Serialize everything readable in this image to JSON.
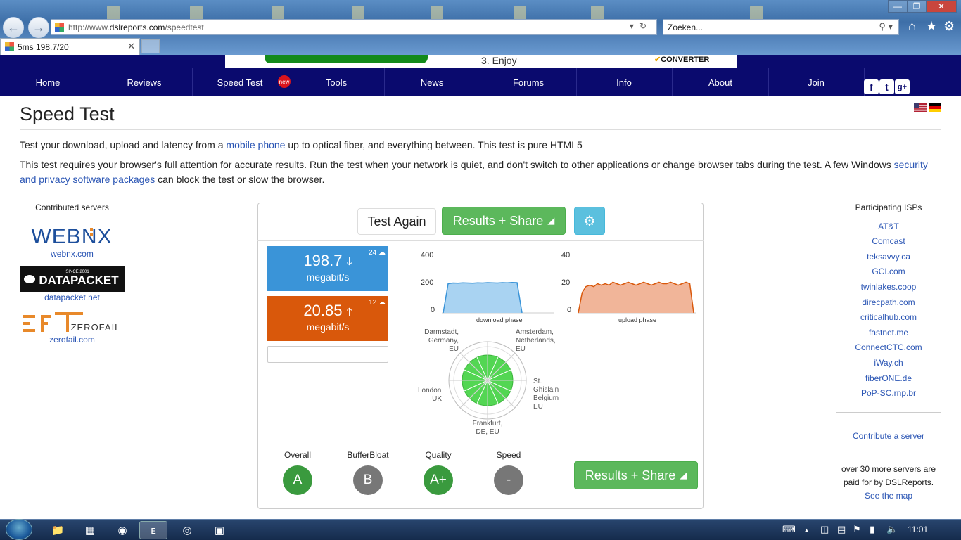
{
  "browser": {
    "url_prefix": "http://www.",
    "url_domain": "dslreports.com",
    "url_path": "/speedtest",
    "search_placeholder": "Zoeken...",
    "tab_title": "5ms 198.7/20"
  },
  "ad": {
    "text": "3. Enjoy",
    "logo": "CONVERTER"
  },
  "nav": {
    "items": [
      "Home",
      "Reviews",
      "Speed Test",
      "Tools",
      "News",
      "Forums",
      "Info",
      "About",
      "Join"
    ],
    "badge": "new",
    "social": [
      "f",
      "t",
      "g+"
    ]
  },
  "page": {
    "title": "Speed Test",
    "intro_prefix": "Test your download, upload and latency from a ",
    "intro_link": "mobile phone",
    "intro_suffix": " up to optical fiber, and everything between. This test is pure HTML5",
    "notice_prefix": "This test requires your browser's full attention for accurate results. Run the test when your network is quiet, and don't switch to other applications or change browser tabs during the test. A few Windows ",
    "notice_link": "security and privacy software packages",
    "notice_suffix": " can block the test or slow the browser."
  },
  "contributed": {
    "heading": "Contributed servers",
    "servers": [
      {
        "logo": "WEBNX",
        "link": "webnx.com"
      },
      {
        "logo": "DATAPACKET",
        "logo_small": "SINCE 2001",
        "link": "datapacket.net"
      },
      {
        "logo": "ZEROFAIL",
        "link": "zerofail.com"
      }
    ]
  },
  "test": {
    "test_again": "Test Again",
    "results_share": "Results + Share",
    "download": {
      "value": "198.7",
      "unit": "megabit/s",
      "streams": "24"
    },
    "upload": {
      "value": "20.85",
      "unit": "megabit/s",
      "streams": "12"
    },
    "download_chart": {
      "ticks": [
        "400",
        "200",
        "0"
      ],
      "label": "download phase"
    },
    "upload_chart": {
      "ticks": [
        "40",
        "20",
        "0"
      ],
      "label": "upload phase"
    },
    "radar_labels": {
      "darmstadt": [
        "Darmstadt,",
        "Germany,",
        "EU"
      ],
      "amsterdam": [
        "Amsterdam,",
        "Netherlands,",
        "EU"
      ],
      "london": [
        "London,",
        "UK"
      ],
      "ghislain": [
        "St.",
        "Ghislain",
        "Belgium",
        "EU"
      ],
      "frankfurt": [
        "Frankfurt,",
        "DE, EU"
      ]
    },
    "grades": [
      {
        "label": "Overall",
        "value": "A",
        "color": "#3a9a3e"
      },
      {
        "label": "BufferBloat",
        "value": "B",
        "color": "#777777"
      },
      {
        "label": "Quality",
        "value": "A+",
        "color": "#3a9a3e"
      },
      {
        "label": "Speed",
        "value": "-",
        "color": "#777777"
      }
    ]
  },
  "chart_data": [
    {
      "type": "area",
      "xlabel": "download phase",
      "ylim": [
        0,
        400
      ],
      "series": [
        {
          "values": [
            0,
            200,
            205,
            204,
            206,
            205,
            204,
            206,
            205,
            207,
            206,
            205,
            207,
            206,
            208,
            207,
            0
          ]
        }
      ]
    },
    {
      "type": "area",
      "xlabel": "upload phase",
      "ylim": [
        0,
        40
      ],
      "series": [
        {
          "values": [
            0,
            14,
            18,
            19,
            18,
            20,
            19,
            20,
            19,
            21,
            20,
            19,
            20,
            21,
            20,
            19,
            20,
            21,
            20,
            19,
            20,
            21,
            20,
            20,
            21,
            20,
            19,
            20,
            21,
            20,
            0
          ]
        }
      ]
    }
  ],
  "isps": {
    "heading": "Participating ISPs",
    "items": [
      "AT&T",
      "Comcast",
      "teksavvy.ca",
      "GCI.com",
      "twinlakes.coop",
      "direcpath.com",
      "criticalhub.com",
      "fastnet.me",
      "ConnectCTC.com",
      "iWay.ch",
      "fiberONE.de",
      "PoP-SC.rnp.br"
    ],
    "contribute": "Contribute a server",
    "more_text": "over 30 more servers are paid for by DSLReports.",
    "see_map": "See the map"
  },
  "taskbar": {
    "time": "11:01"
  },
  "colors": {
    "nav": "#0a0a6e",
    "download": "#3a94d8",
    "upload": "#d9580b",
    "share": "#5cb85c",
    "settings": "#5bc0de"
  }
}
